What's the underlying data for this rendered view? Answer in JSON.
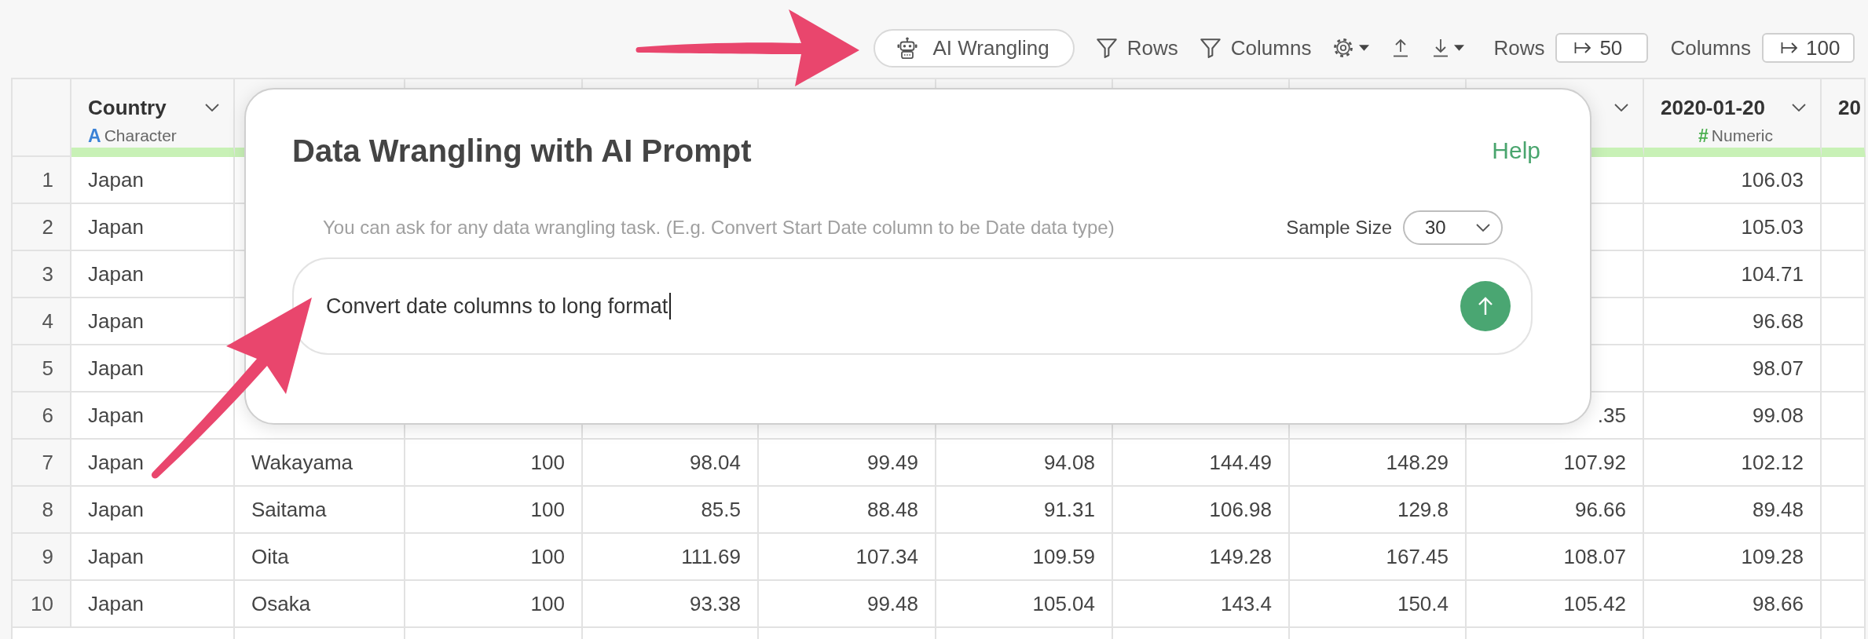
{
  "toolbar": {
    "ai_button": {
      "label": "AI Wrangling"
    },
    "filters": [
      {
        "label": "Rows"
      },
      {
        "label": "Columns"
      }
    ],
    "limits": [
      {
        "label": "Rows",
        "value": "50"
      },
      {
        "label": "Columns",
        "value": "100"
      }
    ]
  },
  "table": {
    "columns": [
      {
        "name": "Country",
        "type": {
          "kind": "character",
          "icon": "A",
          "label": "Character"
        },
        "menu": true
      },
      {},
      {},
      {},
      {},
      {},
      {},
      {},
      {
        "menu": true
      },
      {
        "name": "2020-01-20",
        "type": {
          "kind": "numeric",
          "icon": "#",
          "label": "Numeric"
        },
        "menu": true
      },
      {
        "name": "20"
      }
    ],
    "rows": [
      {
        "number": "1",
        "cells": [
          "Japan",
          null,
          null,
          null,
          null,
          null,
          null,
          null,
          null,
          "106.03",
          null
        ]
      },
      {
        "number": "2",
        "cells": [
          "Japan",
          null,
          null,
          null,
          null,
          null,
          null,
          null,
          null,
          "105.03",
          null
        ]
      },
      {
        "number": "3",
        "cells": [
          "Japan",
          null,
          null,
          null,
          null,
          null,
          null,
          null,
          null,
          "104.71",
          null
        ]
      },
      {
        "number": "4",
        "cells": [
          "Japan",
          null,
          null,
          null,
          null,
          null,
          null,
          null,
          null,
          "96.68",
          null
        ]
      },
      {
        "number": "5",
        "cells": [
          "Japan",
          null,
          null,
          null,
          null,
          null,
          null,
          null,
          null,
          "98.07",
          null
        ]
      },
      {
        "number": "6",
        "cells": [
          "Japan",
          null,
          null,
          null,
          null,
          null,
          null,
          null,
          ".35",
          "99.08",
          null
        ]
      },
      {
        "number": "7",
        "cells": [
          "Japan",
          "Wakayama",
          "100",
          "98.04",
          "99.49",
          "94.08",
          "144.49",
          "148.29",
          "107.92",
          "102.12",
          null
        ]
      },
      {
        "number": "8",
        "cells": [
          "Japan",
          "Saitama",
          "100",
          "85.5",
          "88.48",
          "91.31",
          "106.98",
          "129.8",
          "96.66",
          "89.48",
          null
        ]
      },
      {
        "number": "9",
        "cells": [
          "Japan",
          "Oita",
          "100",
          "111.69",
          "107.34",
          "109.59",
          "149.28",
          "167.45",
          "108.07",
          "109.28",
          null
        ]
      },
      {
        "number": "10",
        "cells": [
          "Japan",
          "Osaka",
          "100",
          "93.38",
          "99.48",
          "105.04",
          "143.4",
          "150.4",
          "105.42",
          "98.66",
          null
        ]
      }
    ]
  },
  "dialog": {
    "title": "Data Wrangling with AI Prompt",
    "help": "Help",
    "hint": "You can ask for any data wrangling task. (E.g. Convert Start Date column to be Date data type)",
    "sample_size": {
      "label": "Sample Size",
      "value": "30"
    },
    "prompt": {
      "value": "Convert date columns to long format"
    }
  }
}
